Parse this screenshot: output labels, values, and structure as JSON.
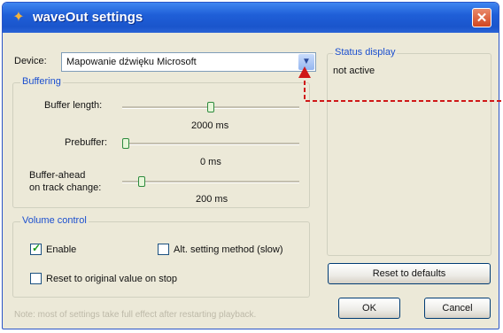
{
  "window": {
    "title": "waveOut settings",
    "close_glyph": "✕"
  },
  "device": {
    "label": "Device:",
    "value": "Mapowanie dźwięku Microsoft"
  },
  "buffering": {
    "legend": "Buffering",
    "buffer_length": {
      "label": "Buffer length:",
      "value_text": "2000 ms"
    },
    "prebuffer": {
      "label": "Prebuffer:",
      "value_text": "0 ms"
    },
    "buffer_ahead": {
      "label_line1": "Buffer-ahead",
      "label_line2": "on track change:",
      "value_text": "200 ms"
    }
  },
  "volume_control": {
    "legend": "Volume control",
    "enable": {
      "label": "Enable",
      "checked": true
    },
    "alt_method": {
      "label": "Alt. setting method (slow)",
      "checked": false
    },
    "reset_original": {
      "label": "Reset to original value on stop",
      "checked": false
    }
  },
  "status": {
    "legend": "Status display",
    "text": "not active"
  },
  "buttons": {
    "reset_defaults": "Reset to defaults",
    "ok": "OK",
    "cancel": "Cancel"
  },
  "note": "Note: most of settings take full effect after restarting playback.",
  "icons": {
    "app": "waveout-app-icon",
    "close": "close-icon",
    "dropdown": "chevron-down-icon"
  },
  "colors": {
    "titlebar": "#1f5fd8",
    "legend_text": "#1b4fcf",
    "annotation": "#d01818",
    "dialog_bg": "#ece9d8"
  }
}
